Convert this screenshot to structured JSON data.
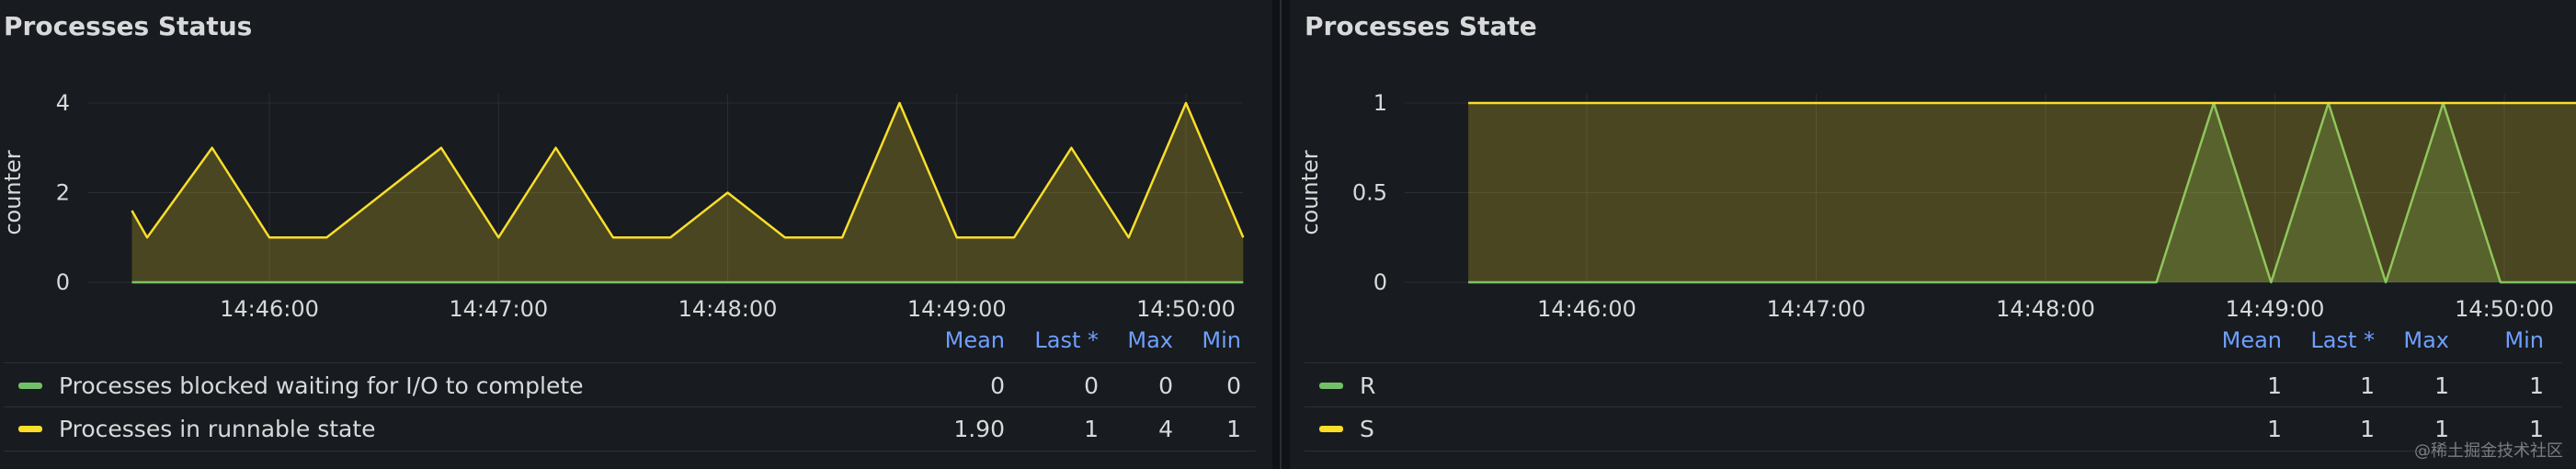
{
  "panel1": {
    "title": "Processes Status",
    "legend_headers": [
      "Mean",
      "Last *",
      "Max",
      "Min"
    ],
    "legend_rows": [
      {
        "name": "Processes blocked waiting for I/O to complete",
        "color": "#73bf69",
        "values": [
          "0",
          "0",
          "0",
          "0"
        ]
      },
      {
        "name": "Processes in runnable state",
        "color": "#fade2a",
        "values": [
          "1.90",
          "1",
          "4",
          "1"
        ]
      }
    ]
  },
  "panel2": {
    "title": "Processes State",
    "legend_headers": [
      "Mean",
      "Last *",
      "Max",
      "Min"
    ],
    "legend_rows": [
      {
        "name": "R",
        "color": "#73bf69",
        "values": [
          "1",
          "1",
          "1",
          "1"
        ]
      },
      {
        "name": "S",
        "color": "#fade2a",
        "values": [
          "1",
          "1",
          "1",
          "1"
        ]
      }
    ]
  },
  "chart_data": [
    {
      "type": "area",
      "title": "Processes Status",
      "ylabel": "counter",
      "xlabel": "",
      "ylim": [
        0,
        4
      ],
      "yticks": [
        "0",
        "2",
        "4"
      ],
      "xticks": [
        "14:46:00",
        "14:47:00",
        "14:48:00",
        "14:49:00",
        "14:50:00"
      ],
      "x": [
        "14:45:24",
        "14:45:28",
        "14:45:45",
        "14:46:00",
        "14:46:15",
        "14:46:30",
        "14:46:45",
        "14:47:00",
        "14:47:15",
        "14:47:30",
        "14:47:45",
        "14:48:00",
        "14:48:15",
        "14:48:30",
        "14:48:45",
        "14:49:00",
        "14:49:15",
        "14:49:30",
        "14:49:45",
        "14:50:00",
        "14:50:15"
      ],
      "series": [
        {
          "name": "Processes blocked waiting for I/O to complete",
          "color": "#73bf69",
          "values": [
            0,
            0,
            0,
            0,
            0,
            0,
            0,
            0,
            0,
            0,
            0,
            0,
            0,
            0,
            0,
            0,
            0,
            0,
            0,
            0,
            0
          ]
        },
        {
          "name": "Processes in runnable state",
          "color": "#fade2a",
          "values": [
            1.6,
            1,
            3,
            1,
            1,
            2,
            3,
            1,
            3,
            1,
            1,
            2,
            1,
            1,
            4,
            1,
            1,
            3,
            1,
            4,
            1
          ]
        }
      ],
      "grid": true,
      "legend": "bottom"
    },
    {
      "type": "area",
      "title": "Processes State",
      "ylabel": "counter",
      "xlabel": "",
      "ylim": [
        0,
        1
      ],
      "yticks": [
        "0",
        "0.5",
        "1"
      ],
      "xticks": [
        "14:46:00",
        "14:47:00",
        "14:48:00",
        "14:49:00",
        "14:50:00"
      ],
      "series": [
        {
          "name": "R",
          "color": "#73bf69",
          "x": [
            "14:45:29",
            "14:48:29",
            "14:48:44",
            "14:48:59",
            "14:49:14",
            "14:49:29",
            "14:49:44",
            "14:49:59",
            "14:50:14",
            "14:50:29"
          ],
          "values": [
            0,
            0,
            1,
            0,
            1,
            0,
            1,
            0,
            0,
            0
          ]
        },
        {
          "name": "S",
          "color": "#fade2a",
          "x": [
            "14:45:29",
            "14:50:29"
          ],
          "values": [
            1,
            1
          ]
        }
      ],
      "grid": true,
      "legend": "bottom"
    }
  ],
  "watermark": "@稀土掘金技术社区"
}
